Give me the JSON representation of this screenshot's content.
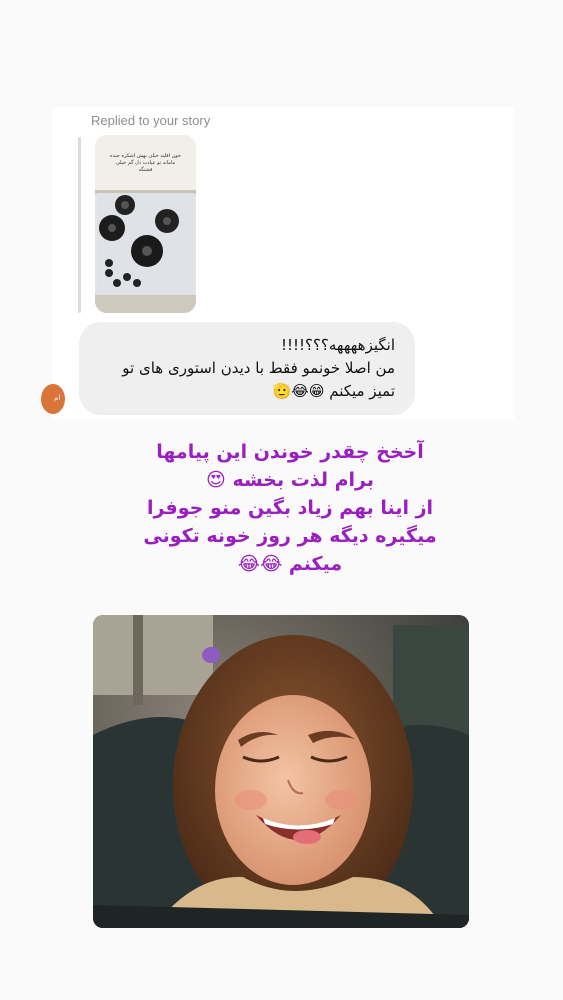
{
  "reply": {
    "label": "Replied to your story",
    "story_caption": "جون اقلید خیلی بهش اشکره جیده مامانه تو عیادت دل گم خیلی قشنگه"
  },
  "message": {
    "lines": [
      "انگیزههههه؟؟؟!!!!",
      "من اصلا خونمو فقط با دیدن استوری های تو",
      "تمیز میکنم 😁😂🫡"
    ]
  },
  "caption": {
    "lines": [
      "آخخخ چقدر خوندن این پیامها",
      "برام لذت بخشه 😍",
      "از اینا بهم زیاد بگین منو جوفرا",
      "میگیره دیگه هر روز خونه تکونی",
      "میکنم 😂😂"
    ]
  },
  "avatar": {
    "text": "ام"
  },
  "colors": {
    "caption": "#9b1fc0",
    "bubble": "#efefef",
    "background": "#fafafa"
  }
}
